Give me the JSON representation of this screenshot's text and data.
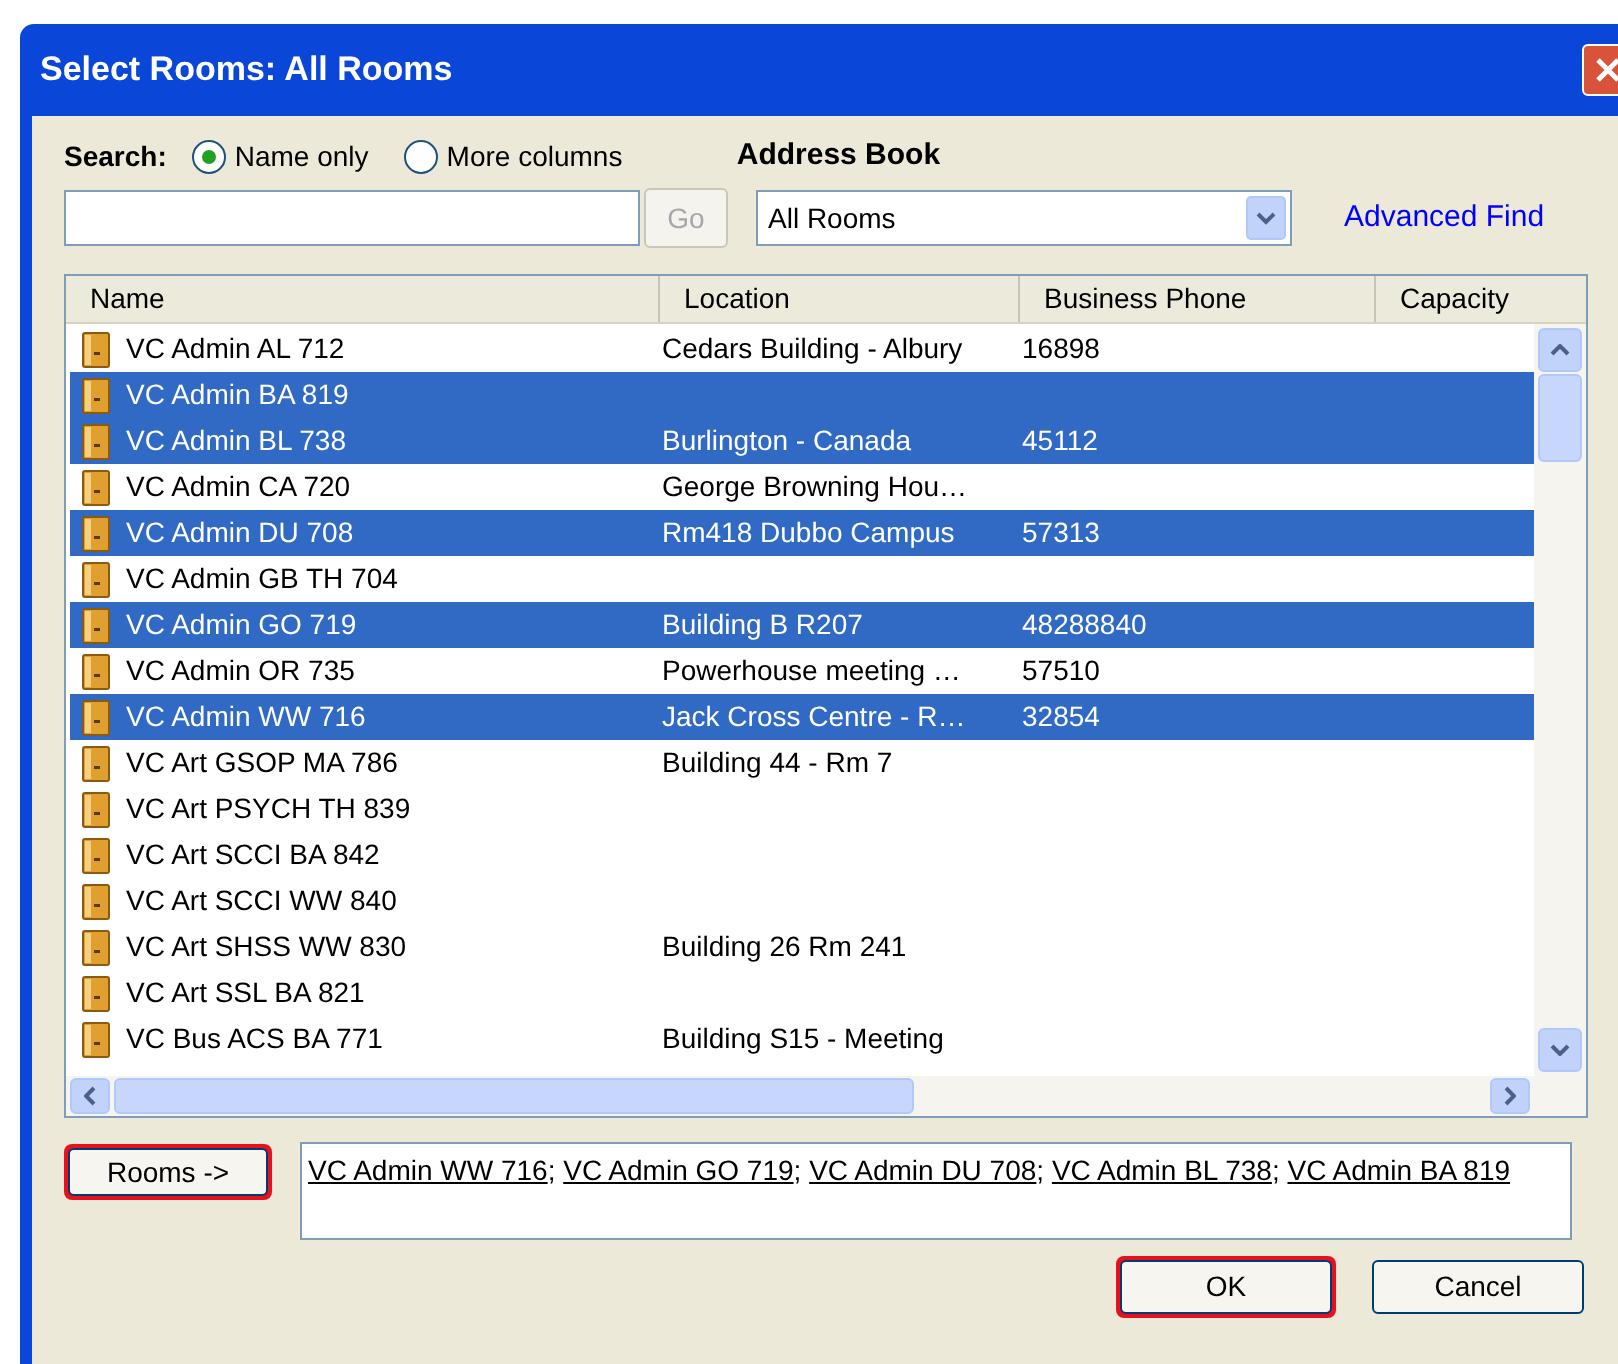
{
  "window": {
    "title": "Select Rooms: All Rooms"
  },
  "search": {
    "label": "Search:",
    "options": [
      {
        "label": "Name only",
        "selected": true
      },
      {
        "label": "More columns",
        "selected": false
      }
    ],
    "go_button": "Go"
  },
  "address_book": {
    "label": "Address Book",
    "value": "All Rooms",
    "advanced_find": "Advanced Find"
  },
  "table": {
    "columns": [
      "Name",
      "Location",
      "Business Phone",
      "Capacity"
    ],
    "rows": [
      {
        "name": "VC Admin AL 712",
        "location": "Cedars Building - Albury",
        "phone": "16898",
        "selected": false
      },
      {
        "name": "VC Admin BA 819",
        "location": "",
        "phone": "",
        "selected": true
      },
      {
        "name": "VC Admin BL 738",
        "location": "Burlington - Canada",
        "phone": "45112",
        "selected": true
      },
      {
        "name": "VC Admin CA 720",
        "location": "George Browning Hou…",
        "phone": "",
        "selected": false
      },
      {
        "name": "VC Admin DU 708",
        "location": "Rm418 Dubbo Campus",
        "phone": "57313",
        "selected": true
      },
      {
        "name": "VC Admin GB TH 704",
        "location": "",
        "phone": "",
        "selected": false
      },
      {
        "name": "VC Admin GO 719",
        "location": "Building B R207",
        "phone": "48288840",
        "selected": true
      },
      {
        "name": "VC Admin OR 735",
        "location": "Powerhouse meeting …",
        "phone": "57510",
        "selected": false
      },
      {
        "name": "VC Admin WW 716",
        "location": "Jack Cross Centre - R…",
        "phone": "32854",
        "selected": true
      },
      {
        "name": "VC Art GSOP MA 786",
        "location": "Building 44 - Rm 7",
        "phone": "",
        "selected": false
      },
      {
        "name": "VC Art PSYCH TH 839",
        "location": "",
        "phone": "",
        "selected": false
      },
      {
        "name": "VC Art SCCI BA 842",
        "location": "",
        "phone": "",
        "selected": false
      },
      {
        "name": "VC Art SCCI WW 840",
        "location": "",
        "phone": "",
        "selected": false
      },
      {
        "name": "VC Art SHSS WW 830",
        "location": "Building 26 Rm 241",
        "phone": "",
        "selected": false
      },
      {
        "name": "VC Art SSL BA 821",
        "location": "",
        "phone": "",
        "selected": false
      },
      {
        "name": "VC Bus ACS BA 771",
        "location": "Building S15 - Meeting",
        "phone": "",
        "selected": false
      }
    ]
  },
  "rooms_button": {
    "label": "Rooms ->",
    "highlighted": true
  },
  "separator": ";",
  "selected_rooms": [
    "VC Admin WW 716",
    "VC Admin GO 719",
    "VC Admin DU 708",
    "VC Admin BL 738",
    "VC Admin BA 819"
  ],
  "buttons": [
    {
      "label": "OK",
      "highlighted": true
    },
    {
      "label": "Cancel",
      "highlighted": false
    }
  ]
}
